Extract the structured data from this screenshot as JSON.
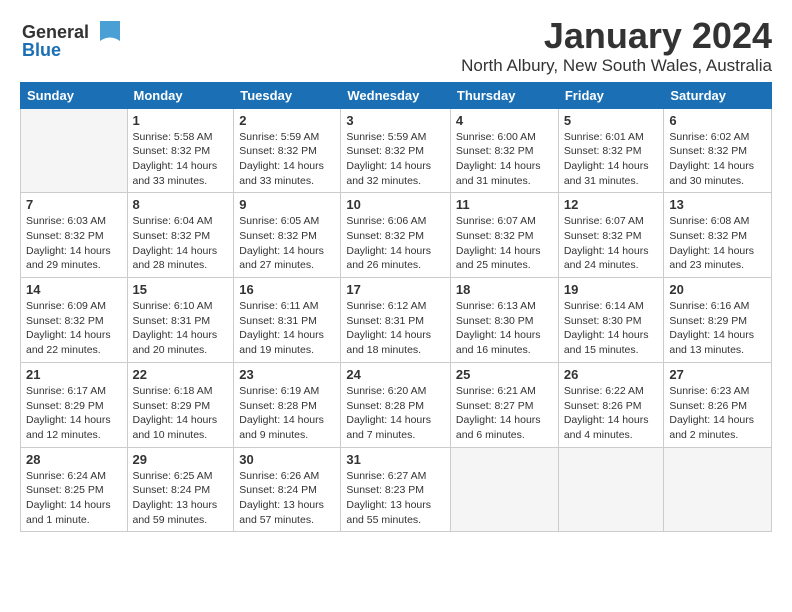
{
  "logo": {
    "text1": "General",
    "text2": "Blue"
  },
  "title": "January 2024",
  "subtitle": "North Albury, New South Wales, Australia",
  "headers": [
    "Sunday",
    "Monday",
    "Tuesday",
    "Wednesday",
    "Thursday",
    "Friday",
    "Saturday"
  ],
  "weeks": [
    [
      {
        "day": "",
        "info": ""
      },
      {
        "day": "1",
        "info": "Sunrise: 5:58 AM\nSunset: 8:32 PM\nDaylight: 14 hours\nand 33 minutes."
      },
      {
        "day": "2",
        "info": "Sunrise: 5:59 AM\nSunset: 8:32 PM\nDaylight: 14 hours\nand 33 minutes."
      },
      {
        "day": "3",
        "info": "Sunrise: 5:59 AM\nSunset: 8:32 PM\nDaylight: 14 hours\nand 32 minutes."
      },
      {
        "day": "4",
        "info": "Sunrise: 6:00 AM\nSunset: 8:32 PM\nDaylight: 14 hours\nand 31 minutes."
      },
      {
        "day": "5",
        "info": "Sunrise: 6:01 AM\nSunset: 8:32 PM\nDaylight: 14 hours\nand 31 minutes."
      },
      {
        "day": "6",
        "info": "Sunrise: 6:02 AM\nSunset: 8:32 PM\nDaylight: 14 hours\nand 30 minutes."
      }
    ],
    [
      {
        "day": "7",
        "info": "Sunrise: 6:03 AM\nSunset: 8:32 PM\nDaylight: 14 hours\nand 29 minutes."
      },
      {
        "day": "8",
        "info": "Sunrise: 6:04 AM\nSunset: 8:32 PM\nDaylight: 14 hours\nand 28 minutes."
      },
      {
        "day": "9",
        "info": "Sunrise: 6:05 AM\nSunset: 8:32 PM\nDaylight: 14 hours\nand 27 minutes."
      },
      {
        "day": "10",
        "info": "Sunrise: 6:06 AM\nSunset: 8:32 PM\nDaylight: 14 hours\nand 26 minutes."
      },
      {
        "day": "11",
        "info": "Sunrise: 6:07 AM\nSunset: 8:32 PM\nDaylight: 14 hours\nand 25 minutes."
      },
      {
        "day": "12",
        "info": "Sunrise: 6:07 AM\nSunset: 8:32 PM\nDaylight: 14 hours\nand 24 minutes."
      },
      {
        "day": "13",
        "info": "Sunrise: 6:08 AM\nSunset: 8:32 PM\nDaylight: 14 hours\nand 23 minutes."
      }
    ],
    [
      {
        "day": "14",
        "info": "Sunrise: 6:09 AM\nSunset: 8:32 PM\nDaylight: 14 hours\nand 22 minutes."
      },
      {
        "day": "15",
        "info": "Sunrise: 6:10 AM\nSunset: 8:31 PM\nDaylight: 14 hours\nand 20 minutes."
      },
      {
        "day": "16",
        "info": "Sunrise: 6:11 AM\nSunset: 8:31 PM\nDaylight: 14 hours\nand 19 minutes."
      },
      {
        "day": "17",
        "info": "Sunrise: 6:12 AM\nSunset: 8:31 PM\nDaylight: 14 hours\nand 18 minutes."
      },
      {
        "day": "18",
        "info": "Sunrise: 6:13 AM\nSunset: 8:30 PM\nDaylight: 14 hours\nand 16 minutes."
      },
      {
        "day": "19",
        "info": "Sunrise: 6:14 AM\nSunset: 8:30 PM\nDaylight: 14 hours\nand 15 minutes."
      },
      {
        "day": "20",
        "info": "Sunrise: 6:16 AM\nSunset: 8:29 PM\nDaylight: 14 hours\nand 13 minutes."
      }
    ],
    [
      {
        "day": "21",
        "info": "Sunrise: 6:17 AM\nSunset: 8:29 PM\nDaylight: 14 hours\nand 12 minutes."
      },
      {
        "day": "22",
        "info": "Sunrise: 6:18 AM\nSunset: 8:29 PM\nDaylight: 14 hours\nand 10 minutes."
      },
      {
        "day": "23",
        "info": "Sunrise: 6:19 AM\nSunset: 8:28 PM\nDaylight: 14 hours\nand 9 minutes."
      },
      {
        "day": "24",
        "info": "Sunrise: 6:20 AM\nSunset: 8:28 PM\nDaylight: 14 hours\nand 7 minutes."
      },
      {
        "day": "25",
        "info": "Sunrise: 6:21 AM\nSunset: 8:27 PM\nDaylight: 14 hours\nand 6 minutes."
      },
      {
        "day": "26",
        "info": "Sunrise: 6:22 AM\nSunset: 8:26 PM\nDaylight: 14 hours\nand 4 minutes."
      },
      {
        "day": "27",
        "info": "Sunrise: 6:23 AM\nSunset: 8:26 PM\nDaylight: 14 hours\nand 2 minutes."
      }
    ],
    [
      {
        "day": "28",
        "info": "Sunrise: 6:24 AM\nSunset: 8:25 PM\nDaylight: 14 hours\nand 1 minute."
      },
      {
        "day": "29",
        "info": "Sunrise: 6:25 AM\nSunset: 8:24 PM\nDaylight: 13 hours\nand 59 minutes."
      },
      {
        "day": "30",
        "info": "Sunrise: 6:26 AM\nSunset: 8:24 PM\nDaylight: 13 hours\nand 57 minutes."
      },
      {
        "day": "31",
        "info": "Sunrise: 6:27 AM\nSunset: 8:23 PM\nDaylight: 13 hours\nand 55 minutes."
      },
      {
        "day": "",
        "info": ""
      },
      {
        "day": "",
        "info": ""
      },
      {
        "day": "",
        "info": ""
      }
    ]
  ]
}
